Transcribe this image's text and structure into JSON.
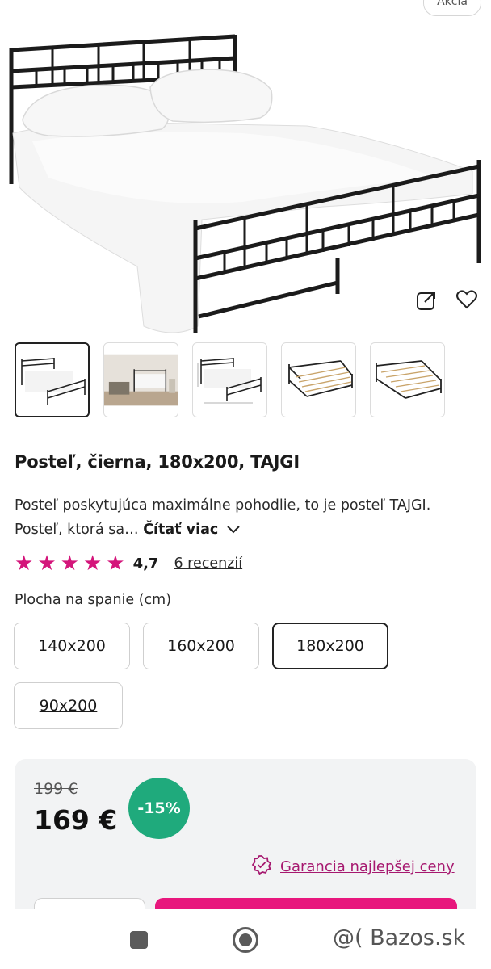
{
  "top_badge": {
    "label": "Akcia"
  },
  "hero": {
    "image": "black-metal-bed-white-bedding",
    "share_icon": "share-icon",
    "favorite_icon": "heart-icon"
  },
  "thumbnails": [
    {
      "name": "thumb-bed-front",
      "selected": true
    },
    {
      "name": "thumb-bed-room"
    },
    {
      "name": "thumb-bed-dimensions"
    },
    {
      "name": "thumb-bed-frame"
    },
    {
      "name": "thumb-bed-frame-slats"
    }
  ],
  "product": {
    "title": "Posteľ, čierna, 180x200, TAJGI",
    "description": "Posteľ poskytujúca maximálne pohodlie, to je posteľ TAJGI. Posteľ, ktorá sa…",
    "read_more": "Čítať viac",
    "rating": 4.7,
    "rating_text": "4,7",
    "reviews_link": "6 recenzií"
  },
  "sizes": {
    "label": "Plocha na spanie (cm)",
    "options": [
      "140x200",
      "160x200",
      "180x200",
      "90x200"
    ],
    "selected": "180x200"
  },
  "pricing": {
    "old_price": "199 €",
    "new_price": "169 €",
    "discount": "-15%",
    "guarantee_link": "Garancia najlepšej ceny"
  },
  "colors": {
    "accent_pink": "#e8177d",
    "star_pink": "#d4157b",
    "discount_green": "#1faa7c",
    "link_purple": "#a6186f"
  },
  "watermark": "@( Bazos.sk"
}
